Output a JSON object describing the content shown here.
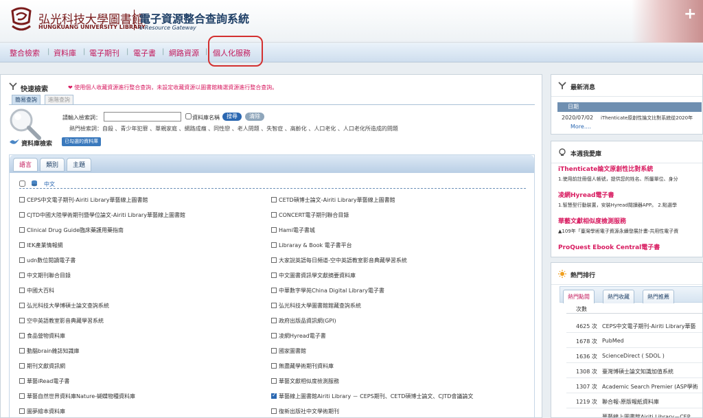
{
  "header": {
    "brand_zh": "弘光科技大學圖書館",
    "brand_en": "HUNGKUANG UNIVERSITY LIBRARY",
    "system_zh": "電子資源整合查詢系統",
    "system_en": "e-Resource Gateway"
  },
  "nav": [
    "整合檢索",
    "資料庫",
    "電子期刊",
    "電子書",
    "網路資源",
    "個人化服務"
  ],
  "quick": {
    "title": "快速檢索",
    "note": "使用個人收藏資源進行整合查詢，未設定收藏資源以圖書館精選資源進行整合查詢。",
    "tab_simple": "簡易查詢",
    "tab_advanced": "進階查詢",
    "keyword_label": "請輸入檢索詞：",
    "keyword_value": "",
    "dbname_label": "資料庫名稱",
    "search_label": "搜尋",
    "clear_label": "清除",
    "hot_keywords": "熱門檢索詞：自殺 、青少年犯罪 、單親家庭 、網路成癮 、同性戀 、老人問題 、失智症 、高齡化 、人口老化 、人口老化所造成的問題"
  },
  "db_search": {
    "title": "資料庫檢索",
    "selected_label": "已勾選的資料庫",
    "tabs": [
      "語言",
      "類別",
      "主題"
    ],
    "lang_label": "中文",
    "items": [
      {
        "label": "CEPS中文電子期刊-Airiti Library華藝線上圖書館",
        "checked": false
      },
      {
        "label": "CETD碩博士論文-Airiti Library華藝線上圖書館",
        "checked": false
      },
      {
        "label": "CJTD中國大陸學術期刊暨學位論文-Airiti Library華藝線上圖書館",
        "checked": false
      },
      {
        "label": "CONCERT電子期刊聯合目錄",
        "checked": false
      },
      {
        "label": "Clinical Drug Guide臨床藥護用藥指南",
        "checked": false
      },
      {
        "label": "Hami電子書城",
        "checked": false
      },
      {
        "label": "IEK產業情報網",
        "checked": false
      },
      {
        "label": "Libraray & Book 電子書平台",
        "checked": false
      },
      {
        "label": "udn數位閱讀電子書",
        "checked": false
      },
      {
        "label": "大家說英語每日頻道-空中英語教室影音典藏學習系統",
        "checked": false
      },
      {
        "label": "中文期刊聯合目錄",
        "checked": false
      },
      {
        "label": "中文圖書資訊學文獻摘要資料庫",
        "checked": false
      },
      {
        "label": "中國大百科",
        "checked": false
      },
      {
        "label": "中華數字學苑China Digital Library電子書",
        "checked": false
      },
      {
        "label": "弘光科技大學博碩士論文查詢系統",
        "checked": false
      },
      {
        "label": "弘光科技大學圖書館館藏查詢系統",
        "checked": false
      },
      {
        "label": "空中英語教室影音典藏學習系統",
        "checked": false
      },
      {
        "label": "政府出版品資訊網(GPI)",
        "checked": false
      },
      {
        "label": "食品營物資料庫",
        "checked": false
      },
      {
        "label": "凌網Hyread電子書",
        "checked": false
      },
      {
        "label": "動腦brain雜誌知識庫",
        "checked": false
      },
      {
        "label": "國家圖書館",
        "checked": false
      },
      {
        "label": "期刊文獻資訊網",
        "checked": false
      },
      {
        "label": "無盡藏學術期刊資料庫",
        "checked": false
      },
      {
        "label": "華藝iRead電子書",
        "checked": false
      },
      {
        "label": "華藝文獻相似度檢測服務",
        "checked": false
      },
      {
        "label": "華藝自然世界資料庫Nature-蝴蝶物種資料庫",
        "checked": false
      },
      {
        "label": "華藝線上圖書館Airiti Library － CEPS期刊、CETD碩博士論文、CJTD會議論文",
        "checked": true
      },
      {
        "label": "圖夢繪本資料庫",
        "checked": false
      },
      {
        "label": "復新出版社中文學術期刊",
        "checked": false
      }
    ]
  },
  "news": {
    "title": "最新消息",
    "header": "日期",
    "date": "2020/07/02",
    "text": "iThenticate原創性論文比對系統從2020年",
    "more": "More...."
  },
  "weekly": {
    "title": "本週我愛庫",
    "items": [
      {
        "title": "iThenticate論文原創性比對系統",
        "desc": "1.使用前註冊個人帳號，提供您的姓名、所屬單位、身分"
      },
      {
        "title": "凌網Hyread電子書",
        "desc": "1.智慧型行動裝置，安裝Hyread閱讀器APP。 2.點選學"
      },
      {
        "title": "華藝文獻相似度檢測服務",
        "desc": "▲109年「臺灣學術電子資源永續發展計畫-共用性電子資"
      },
      {
        "title": "ProQuest Ebook Central電子書",
        "desc": ""
      }
    ]
  },
  "ranking": {
    "title": "熱門排行",
    "tabs": [
      "熱門點閱",
      "熱門收藏",
      "熱門推薦"
    ],
    "header": "次數",
    "rows": [
      {
        "count": "4625 次",
        "name": "CEPS中文電子期刊-Airiti Library華藝"
      },
      {
        "count": "1678 次",
        "name": "PubMed"
      },
      {
        "count": "1636 次",
        "name": "ScienceDirect ( SDOL )"
      },
      {
        "count": "1308 次",
        "name": "臺灣博碩士論文知識加值系統"
      },
      {
        "count": "1307 次",
        "name": "Academic Search Premier (ASP學術"
      },
      {
        "count": "1219 次",
        "name": "聯合報-原版報紙資料庫"
      },
      {
        "count": "",
        "name": "華藝線上圖書館Airiti Library－CEP"
      }
    ]
  },
  "colors": {
    "accent": "#c2185b",
    "brand": "#7a1c1c",
    "link": "#2a67b1"
  }
}
